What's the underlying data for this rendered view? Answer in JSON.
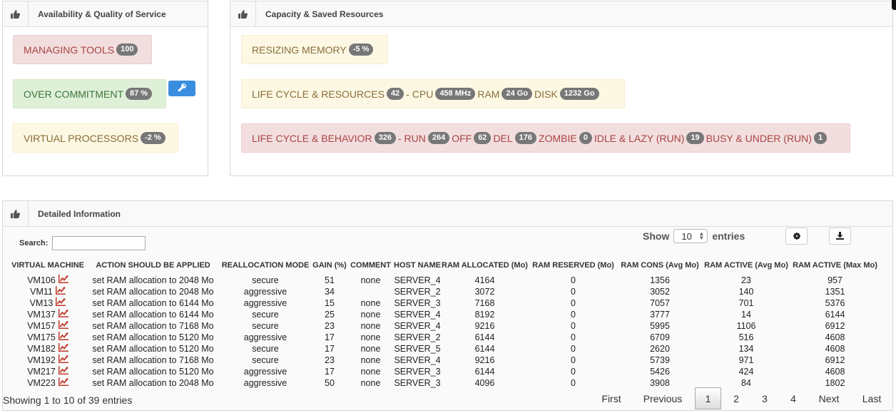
{
  "panels": {
    "availability": {
      "title": "Availability & Quality of Service"
    },
    "capacity": {
      "title": "Capacity & Saved Resources"
    },
    "detailed": {
      "title": "Detailed Information"
    }
  },
  "availability_boxes": {
    "managing_tools": {
      "label": "MANAGING TOOLS",
      "badge": "100"
    },
    "over_commitment": {
      "label": "OVER COMMITMENT",
      "badge": "87 %"
    },
    "virtual_processors": {
      "label": "VIRTUAL PROCESSORS",
      "badge": "-2 %"
    }
  },
  "capacity_boxes": {
    "resizing_memory": {
      "label": "RESIZING MEMORY",
      "badge": "-5 %"
    },
    "life_cycle_resources": {
      "label": "LIFE CYCLE & RESOURCES",
      "count": "42",
      "cpu_label": "- CPU",
      "cpu": "458 MHz",
      "ram_label": "RAM",
      "ram": "24 Go",
      "disk_label": "DISK",
      "disk": "1232 Go"
    },
    "life_cycle_behavior": {
      "label": "LIFE CYCLE & BEHAVIOR",
      "count": "326",
      "run_label": "- RUN",
      "run": "264",
      "off_label": "OFF",
      "off": "62",
      "del_label": "DEL",
      "del": "176",
      "zombie_label": "ZOMBIE",
      "zombie": "0",
      "idle_label": "IDLE & LAZY (RUN)",
      "idle": "19",
      "busy_label": "BUSY & UNDER (RUN)",
      "busy": "1"
    }
  },
  "table_controls": {
    "search_label": "Search:",
    "search_value": "",
    "show_label": "Show",
    "page_size": "10",
    "entries_label": "entries"
  },
  "table": {
    "columns": [
      "VIRTUAL MACHINE",
      "ACTION SHOULD BE APPLIED",
      "REALLOCATION MODE",
      "GAIN (%)",
      "COMMENT",
      "HOST NAME",
      "RAM ALLOCATED (Mo)",
      "RAM RESERVED (Mo)",
      "RAM CONS (Avg Mo)",
      "RAM ACTIVE (Avg Mo)",
      "RAM ACTIVE (Max Mo)"
    ],
    "rows": [
      [
        "VM106",
        "set RAM allocation to 2048 Mo",
        "secure",
        "51",
        "none",
        "SERVER_4",
        "4164",
        "0",
        "1356",
        "23",
        "957"
      ],
      [
        "VM11",
        "set RAM allocation to 2048 Mo",
        "aggressive",
        "34",
        "",
        "SERVER_2",
        "3072",
        "0",
        "3052",
        "140",
        "1351"
      ],
      [
        "VM13",
        "set RAM allocation to 6144 Mo",
        "aggressive",
        "15",
        "none",
        "SERVER_3",
        "7168",
        "0",
        "7057",
        "701",
        "5376"
      ],
      [
        "VM137",
        "set RAM allocation to 6144 Mo",
        "secure",
        "25",
        "none",
        "SERVER_4",
        "8192",
        "0",
        "3777",
        "14",
        "6144"
      ],
      [
        "VM157",
        "set RAM allocation to 7168 Mo",
        "secure",
        "23",
        "none",
        "SERVER_4",
        "9216",
        "0",
        "5995",
        "1106",
        "6912"
      ],
      [
        "VM175",
        "set RAM allocation to 5120 Mo",
        "aggressive",
        "17",
        "none",
        "SERVER_2",
        "6144",
        "0",
        "6709",
        "516",
        "4608"
      ],
      [
        "VM182",
        "set RAM allocation to 5120 Mo",
        "secure",
        "17",
        "none",
        "SERVER_5",
        "6144",
        "0",
        "2620",
        "134",
        "4608"
      ],
      [
        "VM192",
        "set RAM allocation to 7168 Mo",
        "secure",
        "23",
        "none",
        "SERVER_4",
        "9216",
        "0",
        "5739",
        "971",
        "6912"
      ],
      [
        "VM217",
        "set RAM allocation to 5120 Mo",
        "aggressive",
        "17",
        "none",
        "SERVER_3",
        "6144",
        "0",
        "5426",
        "424",
        "4608"
      ],
      [
        "VM223",
        "set RAM allocation to 2048 Mo",
        "aggressive",
        "50",
        "none",
        "SERVER_3",
        "4096",
        "0",
        "3908",
        "84",
        "1802"
      ]
    ]
  },
  "footer": {
    "info": "Showing 1 to 10 of 39 entries",
    "first": "First",
    "previous": "Previous",
    "pages": [
      "1",
      "2",
      "3",
      "4"
    ],
    "next": "Next",
    "last": "Last"
  },
  "icons": {
    "thumb": "thumbs-up-icon",
    "wrench": "wrench-icon",
    "gear": "gear-icon",
    "download": "download-icon",
    "chart": "line-chart-icon"
  },
  "colors": {
    "red_box": "#f2dede",
    "green_box": "#dff0d8",
    "yellow_box": "#fcf8e3",
    "badge": "#777777",
    "wrench_button": "#3a8ee0",
    "chart_icon": "#c0392b"
  }
}
